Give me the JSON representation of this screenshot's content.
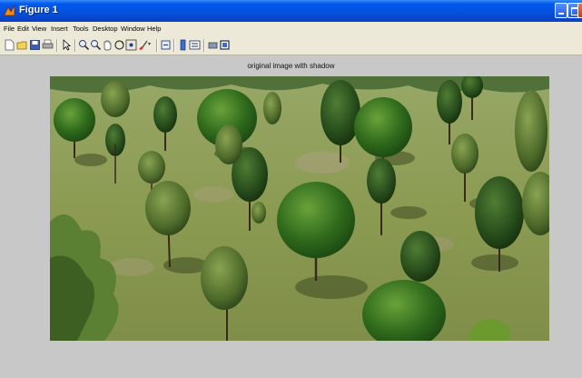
{
  "window": {
    "title": "Figure 1",
    "app_icon": "matlab-figure-icon",
    "controls": [
      "minimize-icon",
      "maximize-icon",
      "close-icon"
    ]
  },
  "menubar": {
    "items": [
      {
        "label": "File"
      },
      {
        "label": "Edit"
      },
      {
        "label": "View"
      },
      {
        "label": "Insert"
      },
      {
        "label": "Tools"
      },
      {
        "label": "Desktop"
      },
      {
        "label": "Window"
      },
      {
        "label": "Help"
      }
    ]
  },
  "toolbar": {
    "icons": [
      "new-figure-icon",
      "open-file-icon",
      "save-icon",
      "print-icon",
      "edit-plot-arrow-icon",
      "zoom-in-icon",
      "zoom-out-icon",
      "pan-hand-icon",
      "rotate-3d-icon",
      "data-cursor-icon",
      "brush-icon",
      "link-plot-icon",
      "insert-colorbar-icon",
      "insert-legend-icon",
      "hide-plot-tools-icon",
      "show-plot-tools-icon"
    ]
  },
  "axes": {
    "title": "original image with shadow",
    "content": "photo of trees on grassy hillside"
  },
  "colors": {
    "titlebar": "#0450dc",
    "chrome": "#ece9d8",
    "figure_background": "#c8c8c8",
    "grass": "#8a9a52"
  }
}
